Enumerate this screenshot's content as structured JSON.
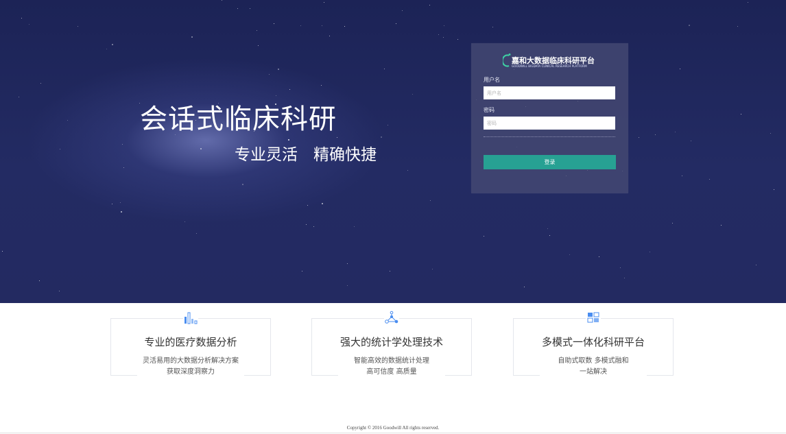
{
  "hero": {
    "headline": "会话式临床科研",
    "subline": "专业灵活　精确快捷"
  },
  "login": {
    "brand_title": "嘉和大数据临床科研平台",
    "brand_subtitle": "GOODWILL BIGDATA CLINICAL RESEARCH PLATFORM",
    "username_label": "用户名",
    "username_placeholder": "用户名",
    "username_value": "",
    "password_label": "密码",
    "password_placeholder": "密码",
    "password_value": "",
    "submit_label": "登录"
  },
  "features": [
    {
      "icon": "bar-chart-icon",
      "title": "专业的医疗数据分析",
      "desc_line1": "灵活易用的大数据分析解决方案",
      "desc_line2": "获取深度洞察力"
    },
    {
      "icon": "network-icon",
      "title": "强大的统计学处理技术",
      "desc_line1": "智能高效的数据统计处理",
      "desc_line2": "高可信度 高质量"
    },
    {
      "icon": "modules-icon",
      "title": "多模式一体化科研平台",
      "desc_line1": "自助式取数 多模式融和",
      "desc_line2": "一站解决"
    }
  ],
  "footer": {
    "copyright": "Copyright © 2016 Goodwill All rights reserved."
  },
  "colors": {
    "hero_bg": "#1c2356",
    "accent": "#27a193",
    "icon_blue": "#4a8df0",
    "brand_green": "#3ecfa3"
  }
}
